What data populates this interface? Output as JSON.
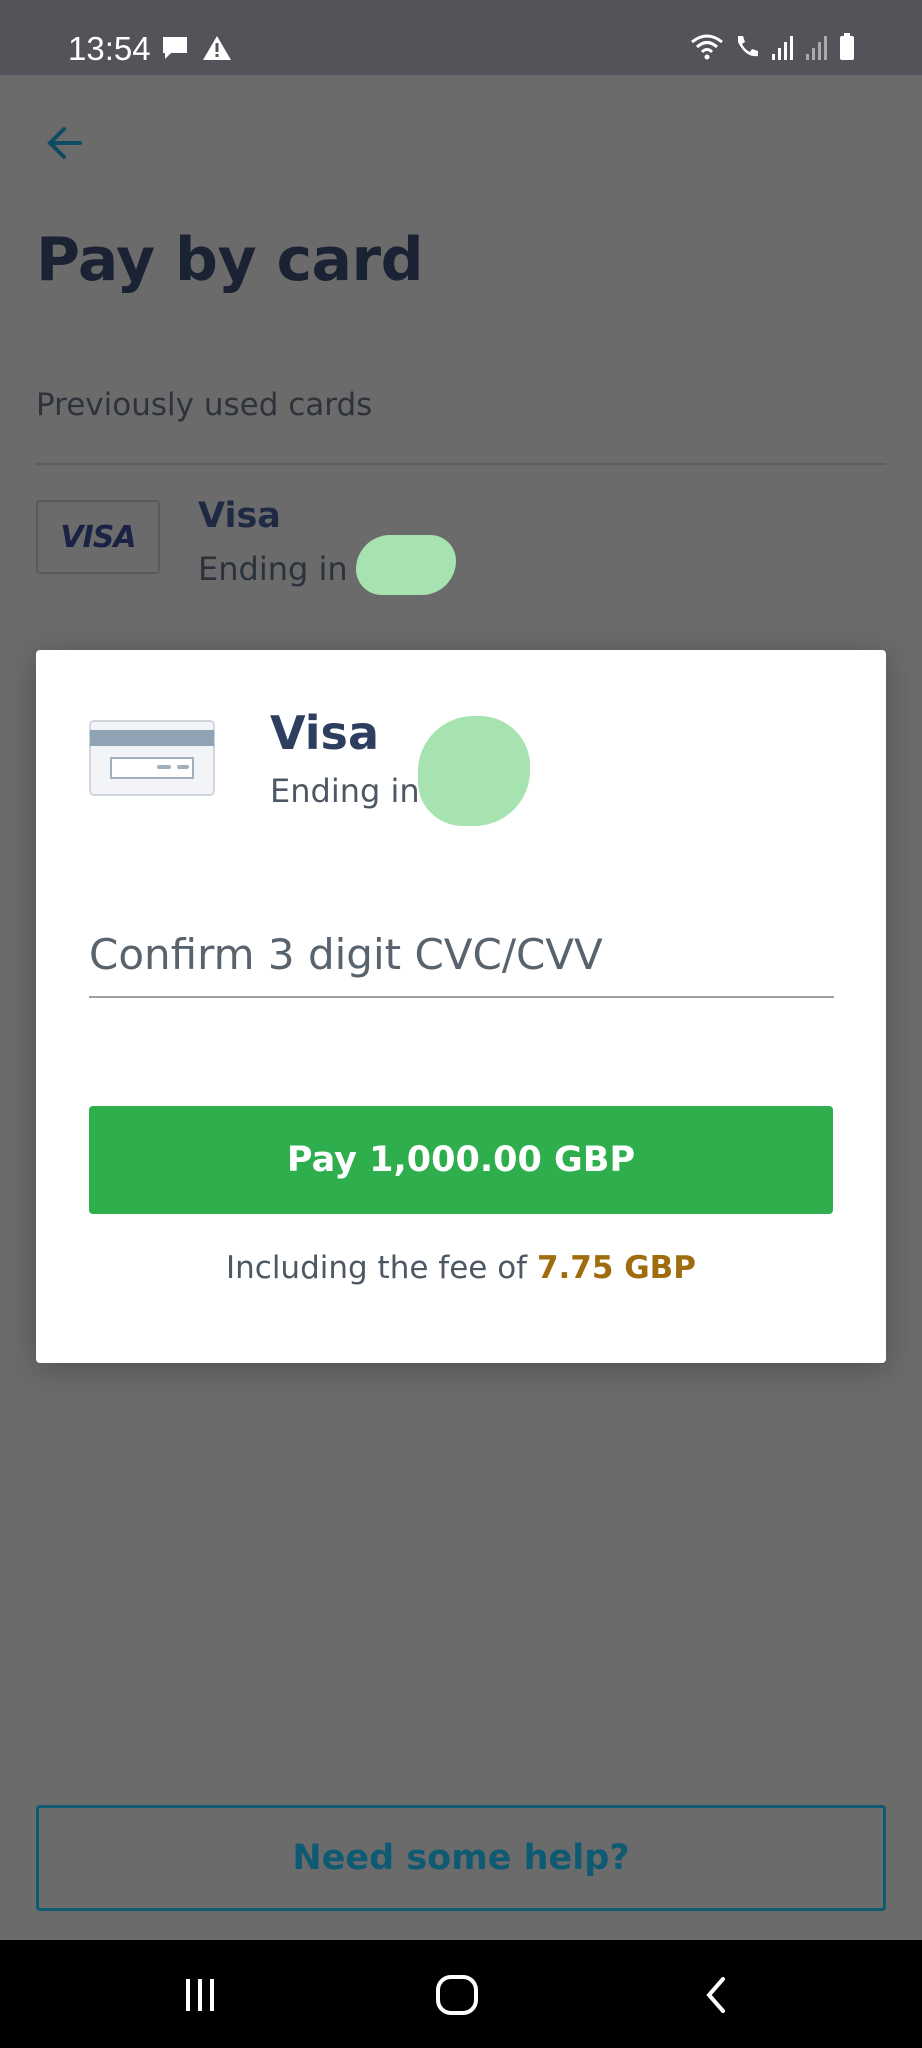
{
  "status_bar": {
    "time": "13:54",
    "icons": [
      "chat-icon",
      "warning-icon",
      "wifi-icon",
      "wifi-calling-icon",
      "signal-roaming-icon",
      "signal-roaming-icon",
      "battery-icon"
    ]
  },
  "page": {
    "title": "Pay by card",
    "section_label": "Previously used cards",
    "saved_card": {
      "logo_text": "VISA",
      "name": "Visa",
      "ending_label": "Ending in"
    },
    "help_button_label": "Need some help?"
  },
  "modal": {
    "card_name": "Visa",
    "ending_label": "Ending in",
    "cvc_placeholder": "Confirm 3 digit CVC/CVV",
    "pay_button_label": "Pay 1,000.00 GBP",
    "fee_prefix": "Including the fee of ",
    "fee_amount": "7.75 GBP"
  },
  "colors": {
    "title": "#1a2233",
    "accent_teal": "#0f5a73",
    "pay_green": "#2fae4d",
    "fee_gold": "#a06d0e",
    "redaction": "#a7e3b0"
  },
  "nav_bar": {
    "buttons": [
      "recent-apps-icon",
      "home-icon",
      "back-icon"
    ]
  }
}
